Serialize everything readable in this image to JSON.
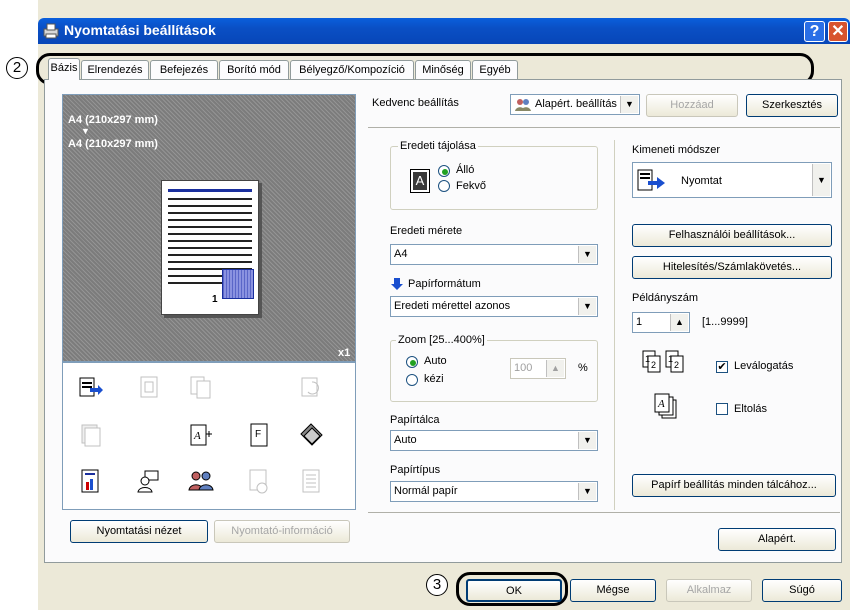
{
  "window": {
    "title": "Nyomtatási beállítások",
    "help_btn": "?",
    "close_btn": "✕"
  },
  "callouts": {
    "c2": "2",
    "c3": "3"
  },
  "tabs": [
    "Bázis",
    "Elrendezés",
    "Befejezés",
    "Borító mód",
    "Bélyegző/Kompozíció",
    "Minőség",
    "Egyéb"
  ],
  "preview": {
    "line1": "A4 (210x297 mm)",
    "arrow": "▼",
    "line2": "A4 (210x297 mm)",
    "copies_mark": "x1",
    "page_number": "1"
  },
  "left_buttons": {
    "print_view": "Nyomtatási nézet",
    "printer_info": "Nyomtató-információ"
  },
  "favorites": {
    "label": "Kedvenc beállítás",
    "value": "Alapért. beállítás",
    "add": "Hozzáad",
    "edit": "Szerkesztés"
  },
  "orientation": {
    "group": "Eredeti tájolása",
    "portrait": "Álló",
    "landscape": "Fekvő",
    "selected": "portrait",
    "icon_letter": "A"
  },
  "original_size": {
    "label": "Eredeti mérete",
    "value": "A4"
  },
  "paper_format": {
    "label": "Papírformátum",
    "value": "Eredeti mérettel azonos"
  },
  "zoom": {
    "group": "Zoom  [25...400%]",
    "auto": "Auto",
    "manual": "kézi",
    "value": "100",
    "unit": "%",
    "selected": "auto"
  },
  "paper_tray": {
    "label": "Papírtálca",
    "value": "Auto"
  },
  "paper_type": {
    "label": "Papírtípus",
    "value": "Normál papír"
  },
  "output_method": {
    "label": "Kimeneti módszer",
    "value": "Nyomtat"
  },
  "right_buttons": {
    "user_settings": "Felhasználói beállítások...",
    "auth": "Hitelesítés/Számlakövetés...",
    "paper_all_trays": "Papírf beállítás minden tálcához..."
  },
  "copies": {
    "label": "Példányszám",
    "value": "1",
    "range": "[1...9999]"
  },
  "collate": {
    "label": "Leválogatás",
    "checked": true,
    "mark": "✔"
  },
  "offset": {
    "label": "Eltolás",
    "checked": false
  },
  "defaults_btn": "Alapért.",
  "footer": {
    "ok": "OK",
    "cancel": "Mégse",
    "apply": "Alkalmaz",
    "help": "Súgó"
  },
  "icons": [
    "print-output-icon",
    "booklet-icon",
    "duplex-icon",
    "rotate-icon",
    "stack-icon",
    "staple-icon",
    "document-icon",
    "cover-icon",
    "bar-chart-icon",
    "user-icon",
    "group-users-icon",
    "template-icon",
    "page-icon"
  ],
  "colors": {
    "titlebar": "#0a4fc4",
    "panel": "#fbfbfc",
    "dialog": "#ece9d8",
    "accent_blue": "#1a4fcf"
  }
}
